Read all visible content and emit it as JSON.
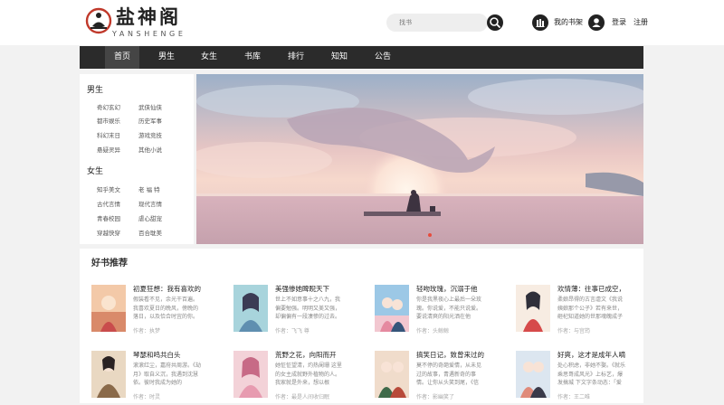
{
  "brand": {
    "title": "盐神阁",
    "subtitle": "YANSHENGE",
    "accent": "#c0392b"
  },
  "search": {
    "placeholder": "找书"
  },
  "header": {
    "shelf_label": "我的书架",
    "login_label": "登录",
    "register_label": "注册"
  },
  "nav": {
    "items": [
      "首页",
      "男生",
      "女生",
      "书库",
      "排行",
      "知知",
      "公告"
    ],
    "active": "首页"
  },
  "sidebar": {
    "male": {
      "heading": "男生",
      "links": [
        "奇幻玄幻",
        "武侠仙侠",
        "都市娱乐",
        "历史军事",
        "科幻末日",
        "游戏竞技",
        "悬疑灵异",
        "其他小说"
      ]
    },
    "female": {
      "heading": "女生",
      "links": [
        "知乎美文",
        "老 福 特",
        "古代言情",
        "现代言情",
        "青春校园",
        "虐心甜宠",
        "穿越快穿",
        "百合耽美"
      ]
    }
  },
  "recommend": {
    "title": "好书推荐",
    "books": [
      {
        "title": "初夏狂想：我有喜欢的",
        "desc": "假装看不见，余光干百遍。我喜欢夏日的晚风，傍晚的落日，以及恰合时宜的你。",
        "author": "作者：执梦"
      },
      {
        "title": "美强惨她睥睨天下",
        "desc": "世上不如意事十之八九，我偏要勉强。明明又美又强，却偏偏有一段凄惨的过去。",
        "author": "作者：飞飞 尊"
      },
      {
        "title": "轻吻玫瑰，沉溺于他",
        "desc": "你是我黑夜心上最后一朵玫瑰。你说爱，不能只说爱。要说清爽的阳光洒在他",
        "author": "作者：头鲸鲸"
      },
      {
        "title": "欢情薄：往事已成空，",
        "desc": "柔娘昂得的古言虐文《我说姨娘那个公子》若有来世，砸杞知道她的世那魂魄成子",
        "author": "作者：与宫筠"
      },
      {
        "title": "琴瑟和鸣共白头",
        "desc": "滚滚红尘，嘉府共周游。《劫月》取自义沉，我遇到沈慧依。彼时我成为她的",
        "author": "作者：时灵"
      },
      {
        "title": "荒野之花，向阳而开",
        "desc": "她怔怔望清，灼热阑珊 这里的女主成就野外植物的人。我家就是外来，想以根",
        "author": "作者：最是人间收归眠"
      },
      {
        "title": "搞笑日记，致曾来过的",
        "desc": "莫不停的奇葩爱情，从未见过的故事，青遇新奇的事情。让你从头笑到尾，《信",
        "author": "作者：影幽笑了"
      },
      {
        "title": "好爽，这才是成年人嘀",
        "desc": "处心积虑，非她不娶。《就乐乘思哥成风光》上标艺，爆发搞城 下文字条动态：「爱",
        "author": "作者：王二唯"
      }
    ]
  },
  "banner": {
    "active_dot_color": "#e74c3c"
  }
}
